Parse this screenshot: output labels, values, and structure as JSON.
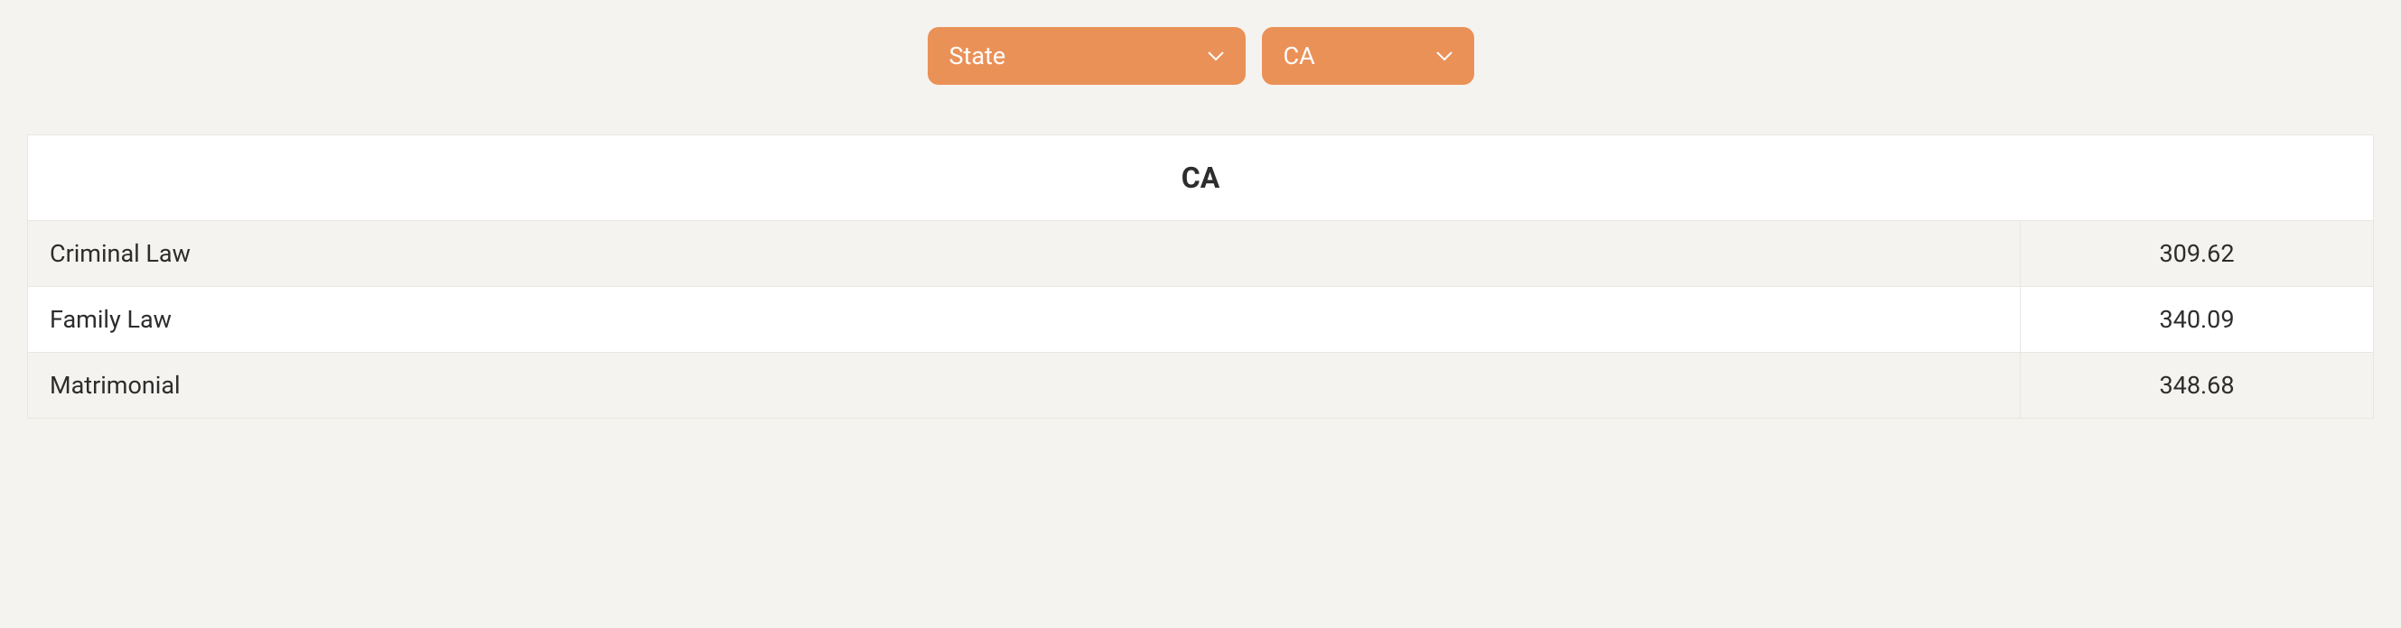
{
  "filters": {
    "category": {
      "label": "State"
    },
    "value": {
      "label": "CA"
    }
  },
  "table": {
    "header": "CA",
    "rows": [
      {
        "label": "Criminal Law",
        "value": "309.62"
      },
      {
        "label": "Family Law",
        "value": "340.09"
      },
      {
        "label": "Matrimonial",
        "value": "348.68"
      }
    ]
  }
}
